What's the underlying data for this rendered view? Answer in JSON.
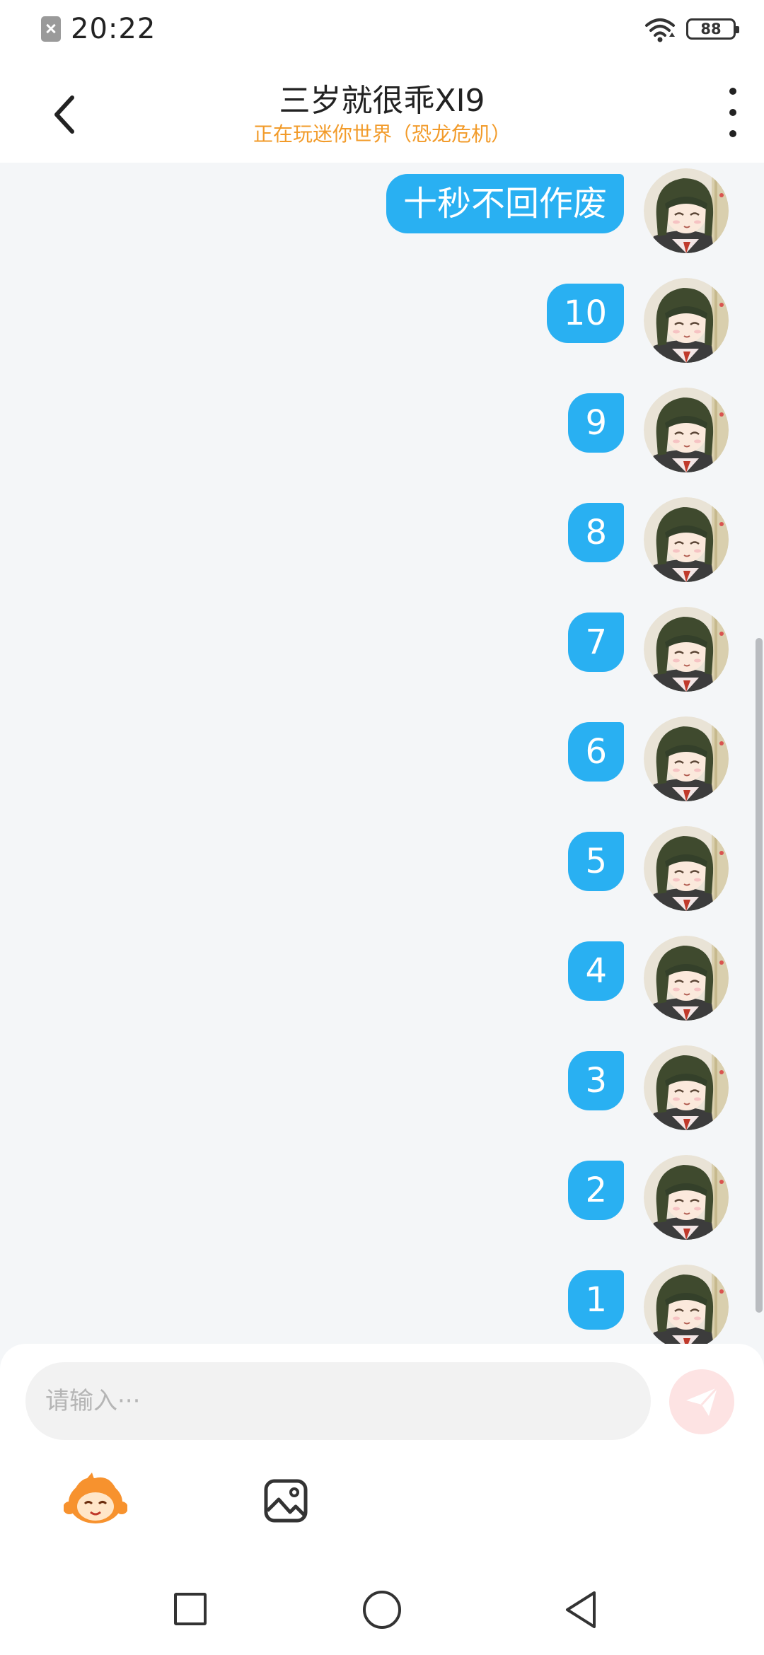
{
  "status_bar": {
    "time": "20:22",
    "battery": "88"
  },
  "header": {
    "title": "三岁就很乖XI9",
    "subtitle": "正在玩迷你世界（恐龙危机）"
  },
  "messages": [
    {
      "text": "十秒不回作废"
    },
    {
      "text": "10"
    },
    {
      "text": "9"
    },
    {
      "text": "8"
    },
    {
      "text": "7"
    },
    {
      "text": "6"
    },
    {
      "text": "5"
    },
    {
      "text": "4"
    },
    {
      "text": "3"
    },
    {
      "text": "2"
    },
    {
      "text": "1"
    }
  ],
  "composer": {
    "placeholder": "请输入···"
  },
  "colors": {
    "bubble": "#29b0f2",
    "subtitle": "#f29b2a",
    "send_button": "#fde3e3"
  },
  "icons": [
    "sim-missing-icon",
    "wifi-icon",
    "battery-icon",
    "back-arrow-icon",
    "more-icon",
    "avatar",
    "send-icon",
    "mascot-emoji-icon",
    "image-icon",
    "recent-apps-icon",
    "home-icon",
    "back-icon"
  ]
}
